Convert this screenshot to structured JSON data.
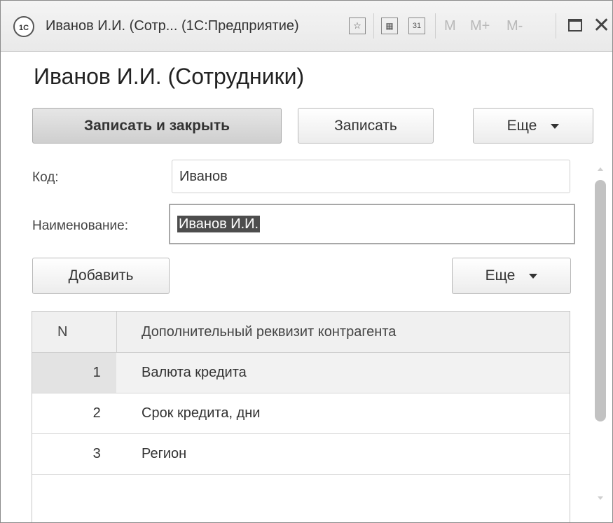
{
  "window": {
    "app_badge": "1С",
    "title": "Иванов И.И. (Сотр...  (1С:Предприятие)",
    "toolbar_icons": [
      "favorite-icon",
      "calculator-icon",
      "calendar-icon"
    ],
    "calendar_label": "31",
    "memory_buttons": [
      "M",
      "M+",
      "M-"
    ]
  },
  "form": {
    "title": "Иванов И.И. (Сотрудники)",
    "buttons": {
      "save_close": "Записать и закрыть",
      "save": "Записать",
      "more": "Еще"
    },
    "fields": {
      "code_label": "Код:",
      "code_value": "Иванов",
      "name_label": "Наименование:",
      "name_value": "Иванов И.И."
    }
  },
  "table": {
    "add_button": "Добавить",
    "more_button": "Еще",
    "columns": [
      "N",
      "Дополнительный реквизит контрагента"
    ],
    "rows": [
      {
        "n": "1",
        "text": "Валюта кредита"
      },
      {
        "n": "2",
        "text": "Срок кредита, дни"
      },
      {
        "n": "3",
        "text": "Регион"
      }
    ]
  }
}
